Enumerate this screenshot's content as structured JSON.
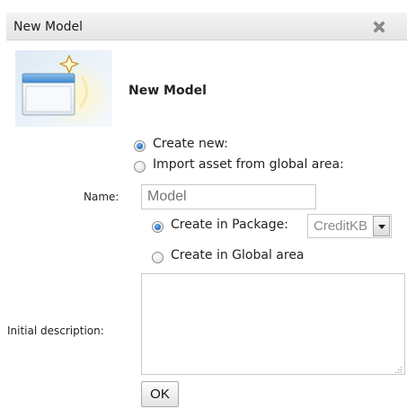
{
  "dialog": {
    "title": "New Model",
    "close_icon": "close-x-icon"
  },
  "banner": {
    "icon": "new-window-sparkle-icon",
    "title": "New Model"
  },
  "mode": {
    "create_new_label": "Create new:",
    "import_label": "Import asset from global area:",
    "selected": "create_new"
  },
  "form": {
    "name_label": "Name:",
    "name_placeholder": "Model",
    "create_in_package_label": "Create in Package:",
    "package_selected": "CreditKB",
    "create_in_global_label": "Create in Global area",
    "location_selected": "package",
    "description_label": "Initial description:",
    "description_value": ""
  },
  "actions": {
    "ok_label": "OK"
  },
  "colors": {
    "titlebar": "#e9e9e9",
    "radio_checked": "#2a74c9"
  }
}
